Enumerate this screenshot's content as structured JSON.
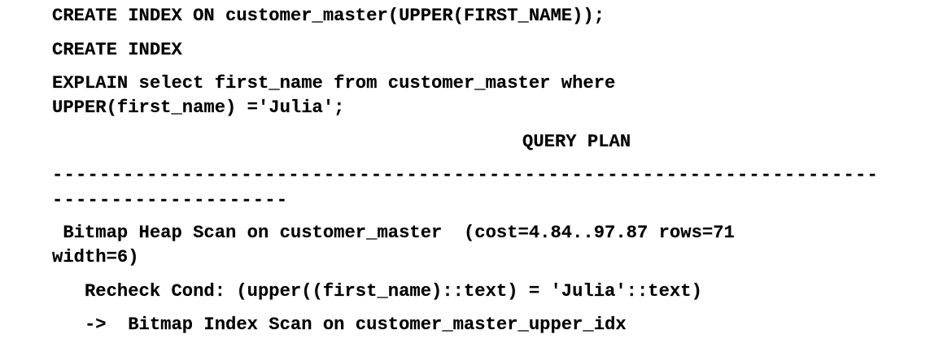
{
  "statements": {
    "create_index_expr": "CREATE INDEX ON customer_master(UPPER(FIRST_NAME));",
    "create_index_result": "CREATE INDEX",
    "explain_line1": "EXPLAIN select first_name from customer_master where",
    "explain_line2": "UPPER(first_name) ='Julia';"
  },
  "query_plan": {
    "header": "QUERY PLAN",
    "separator_line1": "----------------------------------------------------------------------",
    "separator_line2": "--------------------",
    "heap_scan_line1": " Bitmap Heap Scan on customer_master  (cost=4.84..97.87 rows=71",
    "heap_scan_line2": "width=6)",
    "recheck_cond": "   Recheck Cond: (upper((first_name)::text) = 'Julia'::text)",
    "index_scan": "   ->  Bitmap Index Scan on customer_master_upper_idx"
  }
}
